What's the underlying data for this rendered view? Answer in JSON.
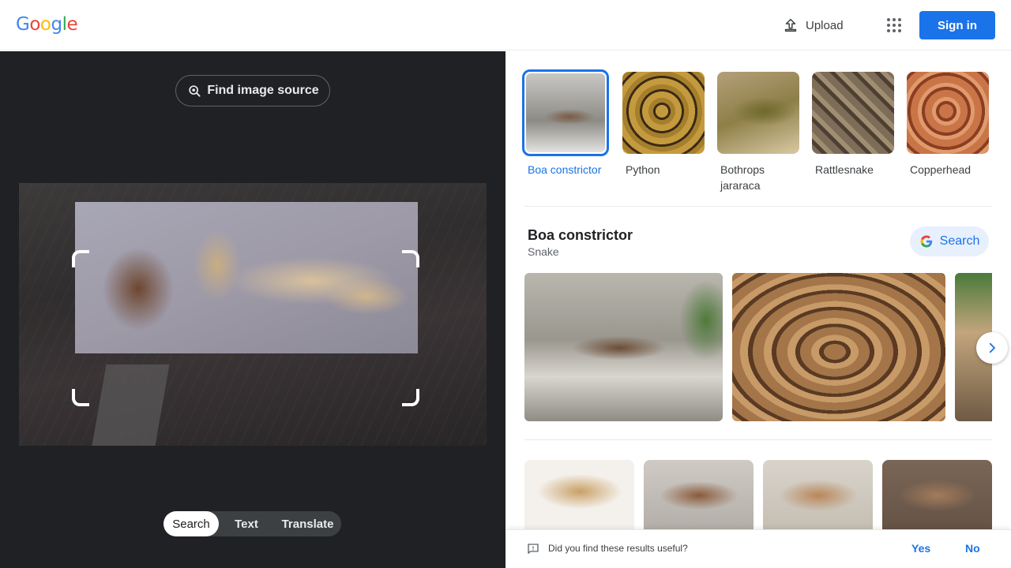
{
  "header": {
    "logo_letters": [
      "G",
      "o",
      "o",
      "g",
      "l",
      "e"
    ],
    "logo_colors": [
      "#4285F4",
      "#EA4335",
      "#FBBC05",
      "#4285F4",
      "#34A853",
      "#EA4335"
    ],
    "upload_label": "Upload",
    "apps_icon": "apps-grid-icon",
    "signin_label": "Sign in"
  },
  "left_panel": {
    "find_source_label": "Find image source",
    "find_source_icon": "lens-search-icon",
    "modes": [
      {
        "label": "Search",
        "active": true
      },
      {
        "label": "Text",
        "active": false
      },
      {
        "label": "Translate",
        "active": false
      }
    ]
  },
  "related": {
    "chips": [
      {
        "label": "Boa constrictor",
        "selected": true,
        "color": "#9a8b7c"
      },
      {
        "label": "Python",
        "selected": false,
        "color": "#b08a3e"
      },
      {
        "label": "Bothrops jararaca",
        "selected": false,
        "color": "#8e7f48"
      },
      {
        "label": "Rattlesnake",
        "selected": false,
        "color": "#6b5c4a"
      },
      {
        "label": "Copperhead",
        "selected": false,
        "color": "#b0603e"
      }
    ]
  },
  "knowledge_panel": {
    "title": "Boa constrictor",
    "subtitle": "Snake",
    "search_label": "Search"
  },
  "feedback": {
    "question": "Did you find these results useful?",
    "yes_label": "Yes",
    "no_label": "No"
  },
  "colors": {
    "accent": "#1a73e8",
    "dark_panel": "#202124"
  }
}
